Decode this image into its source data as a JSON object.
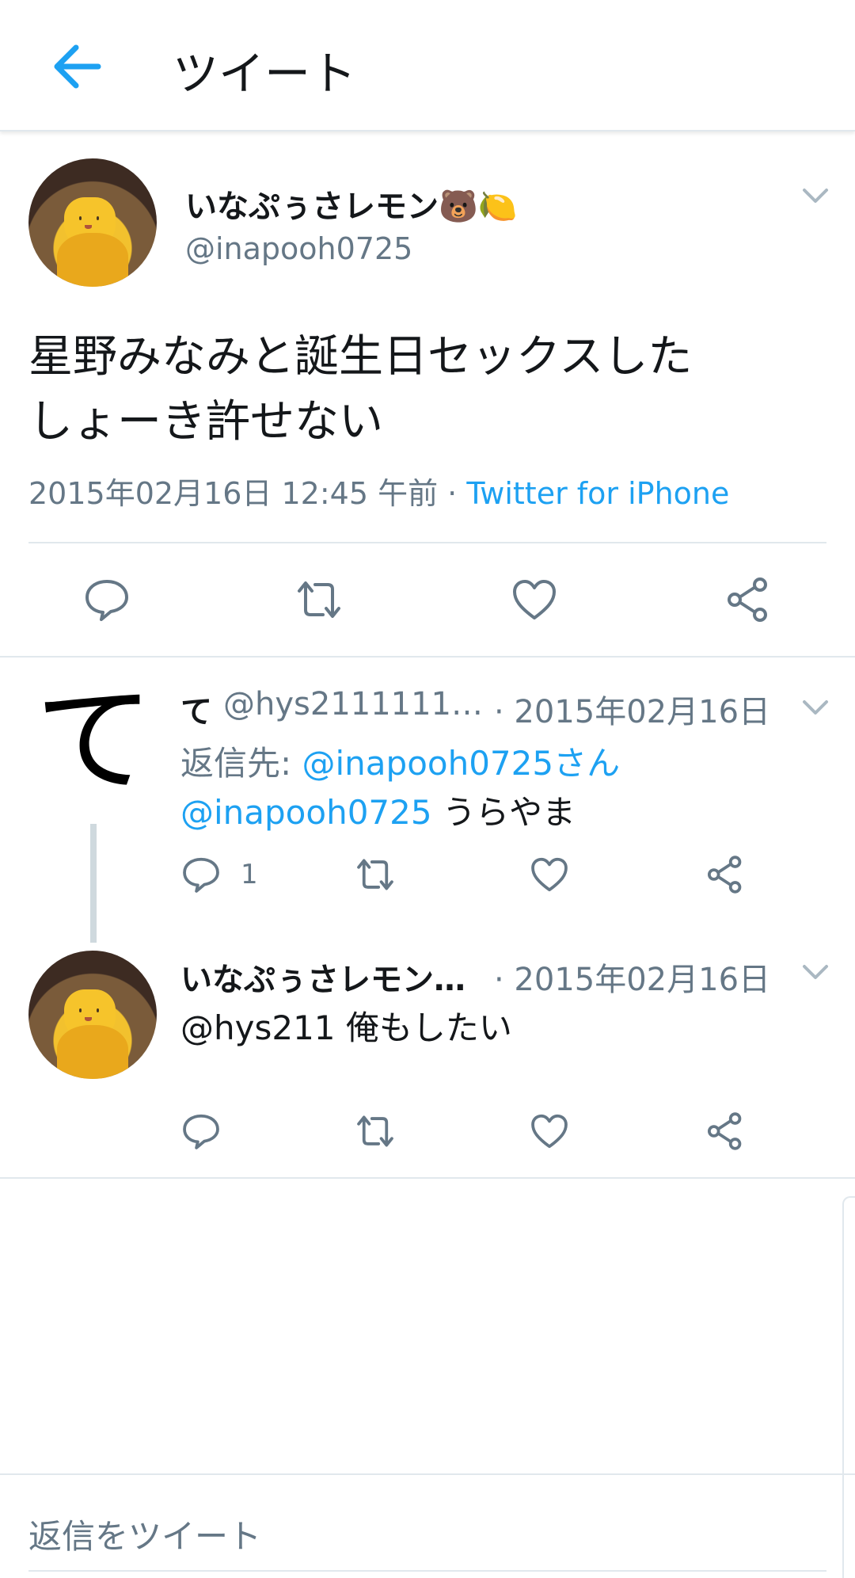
{
  "header": {
    "title": "ツイート",
    "back_icon": "back-arrow-icon",
    "accent": "#1da1f2"
  },
  "main_tweet": {
    "name": "いなぷぅさレモン🐻🍋",
    "handle": "@inapooh0725",
    "text_line1": "星野みなみと誕生日セックスした",
    "text_line2": "しょーき許せない",
    "timestamp": "2015年02月16日 12:45 午前",
    "separator": " · ",
    "source": "Twitter for iPhone"
  },
  "reply1": {
    "avatar_char": "て",
    "name": "て",
    "handle": "@hys2111111…",
    "date": "· 2015年02月16日",
    "reply_to_label": "返信先: ",
    "reply_to_user": "@inapooh0725さん",
    "mention": "@inapooh0725",
    "text": " うらやま",
    "reply_count": "1"
  },
  "reply2": {
    "name": "いなぷぅさレモン…",
    "date": "· 2015年02月16日",
    "text": "@hys211 俺もしたい"
  },
  "reply_bar": {
    "placeholder": "返信をツイート"
  }
}
